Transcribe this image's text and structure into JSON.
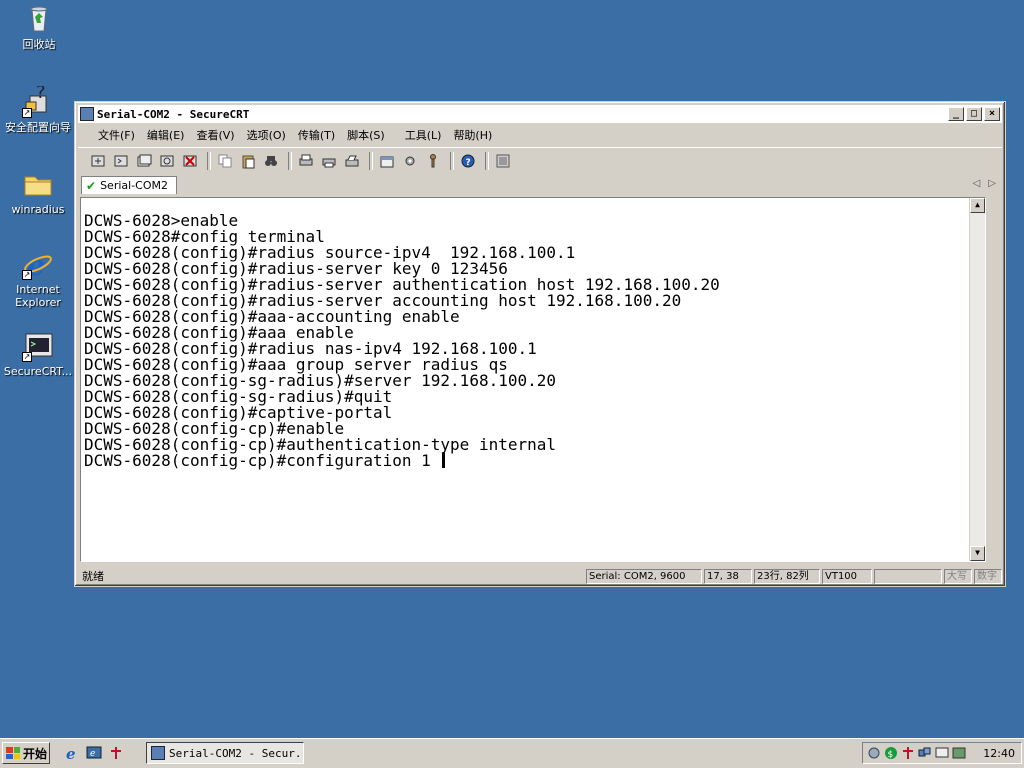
{
  "desktop": {
    "icons": [
      {
        "label": "回收站"
      },
      {
        "label": "安全配置向导"
      },
      {
        "label": "winradius"
      },
      {
        "label": "Internet Explorer"
      },
      {
        "label": "SecureCRT..."
      }
    ]
  },
  "window": {
    "title": "Serial-COM2 - SecureCRT",
    "controls": {
      "minimize": "_",
      "maximize": "□",
      "close": "×"
    },
    "menu": [
      "文件(F)",
      "编辑(E)",
      "查看(V)",
      "选项(O)",
      "传输(T)",
      "脚本(S)",
      "工具(L)",
      "帮助(H)"
    ],
    "tab": {
      "label": "Serial-COM2"
    },
    "terminal": {
      "lines": [
        "DCWS-6028>enable",
        "DCWS-6028#config terminal",
        "DCWS-6028(config)#radius source-ipv4  192.168.100.1",
        "DCWS-6028(config)#radius-server key 0 123456",
        "DCWS-6028(config)#radius-server authentication host 192.168.100.20",
        "DCWS-6028(config)#radius-server accounting host 192.168.100.20",
        "DCWS-6028(config)#aaa-accounting enable",
        "DCWS-6028(config)#aaa enable",
        "DCWS-6028(config)#radius nas-ipv4 192.168.100.1",
        "DCWS-6028(config)#aaa group server radius qs",
        "DCWS-6028(config-sg-radius)#server 192.168.100.20",
        "DCWS-6028(config-sg-radius)#quit",
        "DCWS-6028(config)#captive-portal",
        "DCWS-6028(config-cp)#enable",
        "DCWS-6028(config-cp)#authentication-type internal",
        "DCWS-6028(config-cp)#configuration 1 "
      ]
    },
    "status": {
      "main": "就绪",
      "connection": "Serial: COM2, 9600",
      "cursor_pos": "17, 38",
      "size": "23行, 82列",
      "emulation": "VT100",
      "empty": "",
      "caps": "大写",
      "num": "数字"
    }
  },
  "taskbar": {
    "start_label": "开始",
    "task_label": "Serial-COM2 - Secur...",
    "clock": "12:40"
  },
  "colors": {
    "desktop": "#3a6ea5",
    "chrome": "#d4d0c8",
    "terminal_bg": "#ffffff"
  }
}
